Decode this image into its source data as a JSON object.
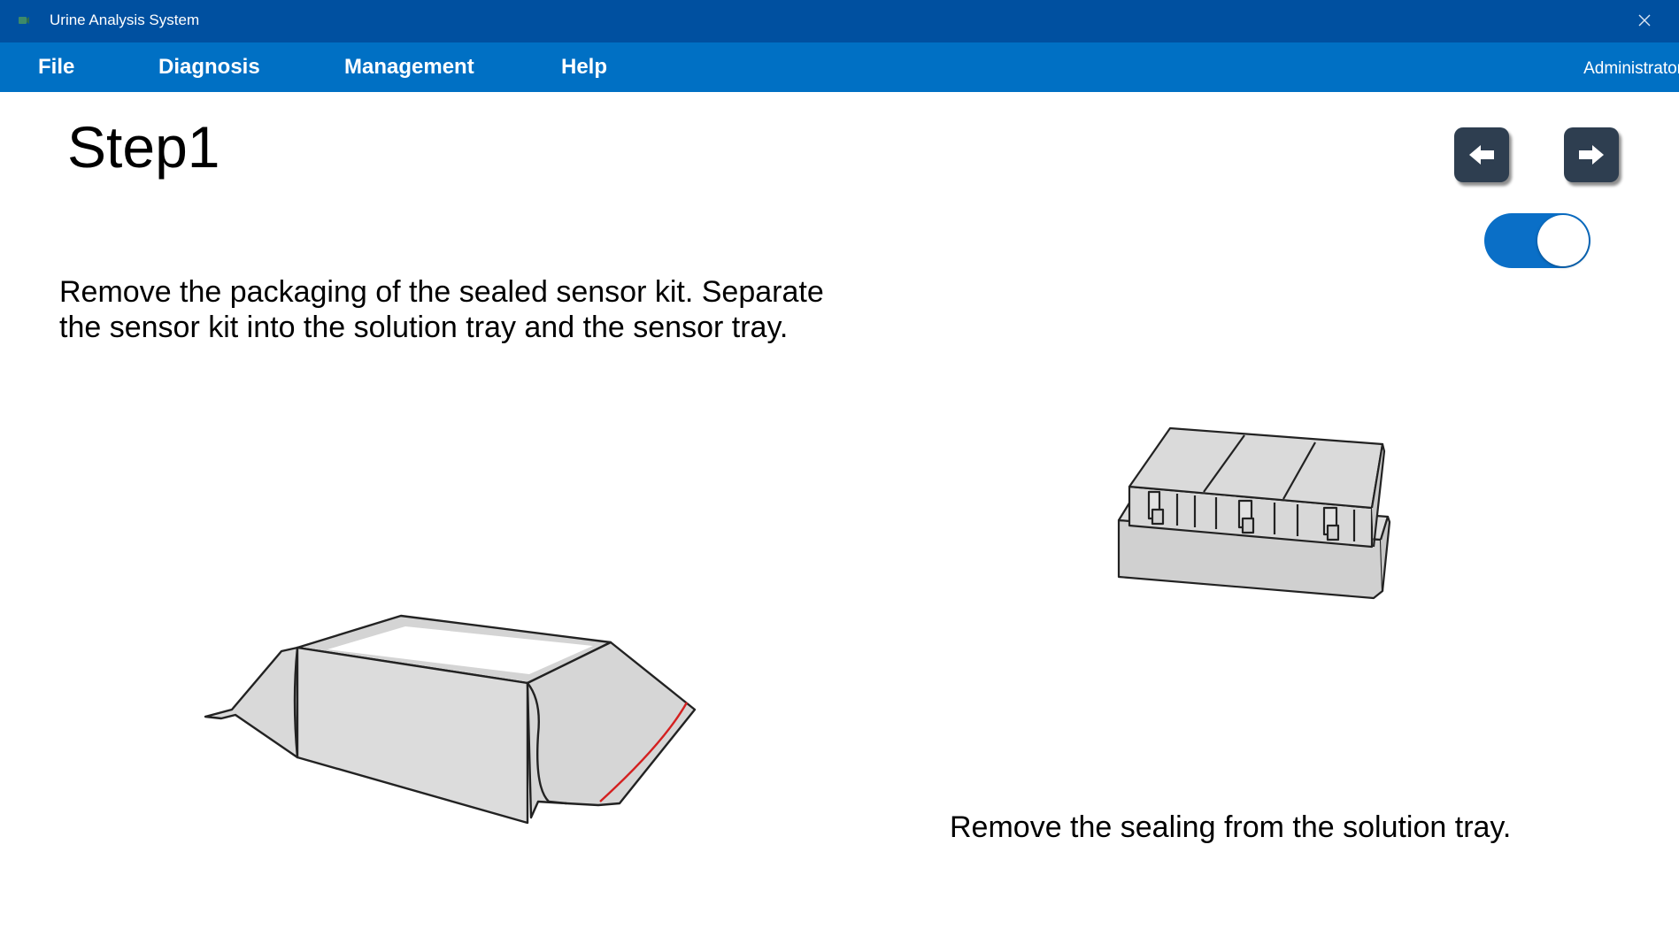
{
  "window": {
    "title": "Urine Analysis System",
    "close_glyph": "✕"
  },
  "menu": {
    "items": [
      {
        "label": "File"
      },
      {
        "label": "Diagnosis"
      },
      {
        "label": "Management"
      },
      {
        "label": "Help"
      }
    ],
    "user": "Administrator"
  },
  "step": {
    "title": "Step1",
    "instruction": "Remove the packaging of the sealed sensor kit. Separate the sensor kit into the solution tray and the sensor tray.",
    "caption_right": "Remove the sealing from the solution tray."
  },
  "nav": {
    "prev_icon": "arrow-left-icon",
    "next_icon": "arrow-right-icon"
  },
  "toggle": {
    "state": "on"
  },
  "colors": {
    "titlebar": "#0050a0",
    "menubar": "#0070c4",
    "nav_button": "#2e3e50",
    "toggle_on": "#0a6fc7",
    "tear_line": "#d42020"
  }
}
